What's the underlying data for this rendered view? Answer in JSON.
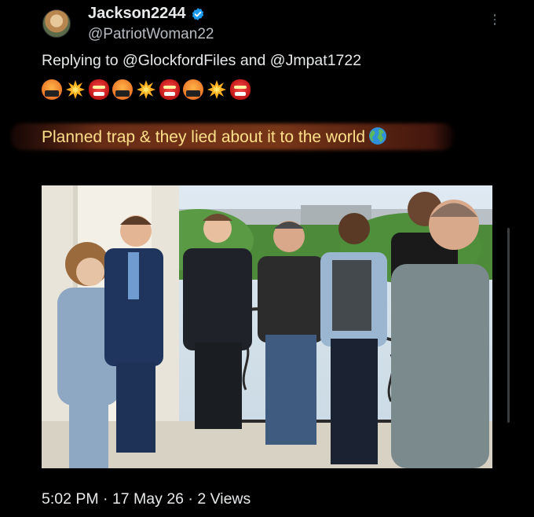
{
  "post": {
    "display_name": "Jackson2244",
    "handle": "@PatriotWoman22",
    "reply_prefix": "Replying to",
    "reply_mention_1": "@GlockfordFiles",
    "reply_and": "and",
    "reply_mention_2": "@Jmpat1722",
    "emojis": [
      "angry-face-icon",
      "collision-icon",
      "ogre-icon",
      "angry-face-icon",
      "collision-icon",
      "ogre-icon",
      "angry-face-icon",
      "collision-icon",
      "ogre-icon"
    ],
    "text": "Planned trap & they lied about it to the world",
    "timestamp": "5:02 PM · 17 May 26 · 2 Views"
  },
  "colors": {
    "background": "#000000",
    "text": "#e7e9ea",
    "secondary": "#b7bcc1",
    "verified": "#1d9bf0",
    "highlight_text": "#ffe08a"
  }
}
